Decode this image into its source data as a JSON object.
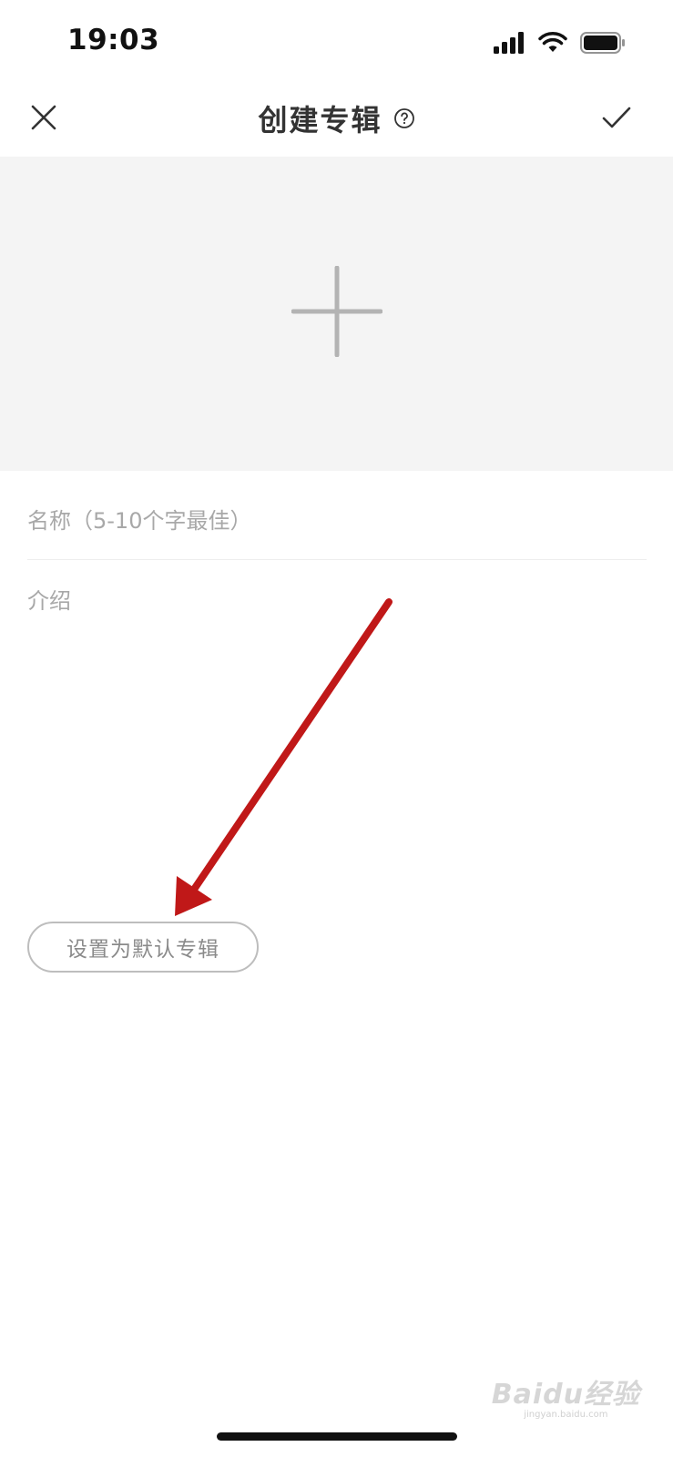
{
  "status_bar": {
    "time": "19:03"
  },
  "nav": {
    "title": "创建专辑",
    "close_icon": "close-icon",
    "help_icon": "help-circle-icon",
    "confirm_icon": "check-icon"
  },
  "cover": {
    "add_icon": "plus-icon"
  },
  "form": {
    "name_placeholder": "名称（5-10个字最佳）",
    "name_value": "",
    "intro_placeholder": "介绍",
    "intro_value": "",
    "default_album_label": "设置为默认专辑"
  },
  "watermark": {
    "logo": "Baidu经验",
    "url": "jingyan.baidu.com"
  },
  "colors": {
    "accent_arrow": "#c01818",
    "placeholder": "#a8a8a8",
    "cover_bg": "#f4f4f4"
  }
}
